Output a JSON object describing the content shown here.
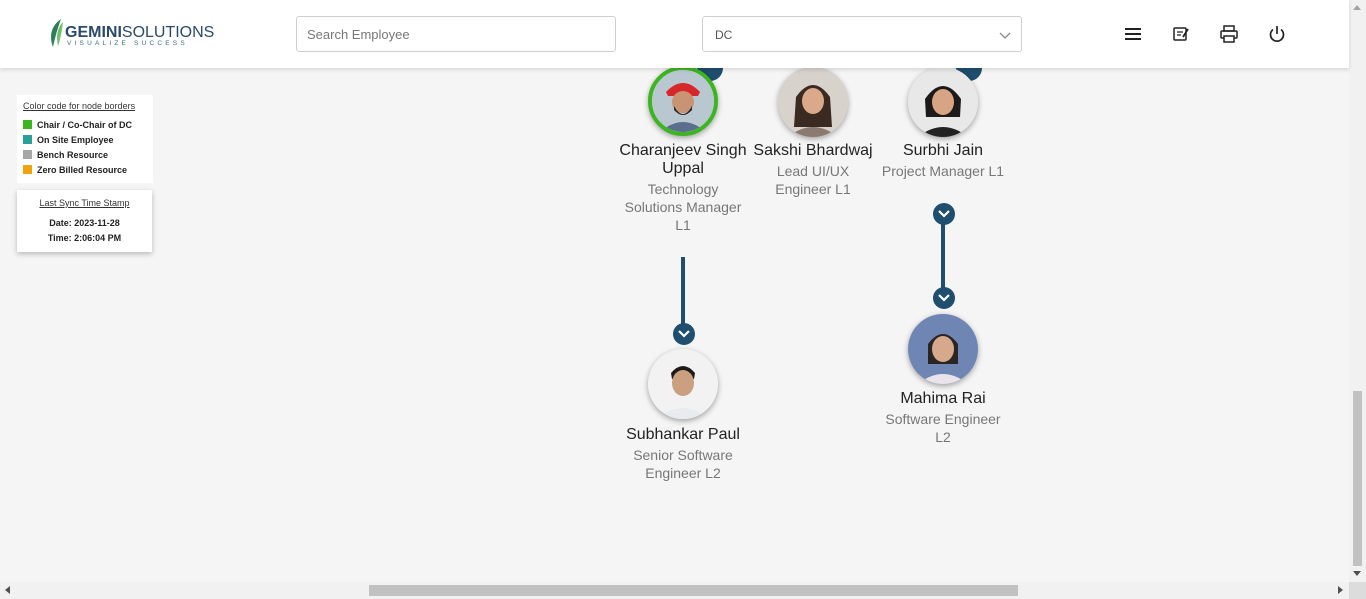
{
  "header": {
    "logo_brand": "GEMINI",
    "logo_word": "SOLUTIONS",
    "logo_tagline": "VISUALIZE SUCCESS",
    "search_placeholder": "Search Employee",
    "department_selected": "DC",
    "icons": [
      "menu-icon",
      "edit-note-icon",
      "print-icon",
      "power-icon"
    ]
  },
  "legend": {
    "title": "Color code for node borders",
    "items": [
      {
        "label": "Chair / Co-Chair of DC",
        "color": "#3cb521"
      },
      {
        "label": "On Site Employee",
        "color": "#2aa198"
      },
      {
        "label": "Bench Resource",
        "color": "#a6a6a6"
      },
      {
        "label": "Zero Billed Resource",
        "color": "#f0a30a"
      }
    ]
  },
  "sync": {
    "title": "Last Sync Time Stamp",
    "date": "Date: 2023-11-28",
    "time": "Time: 2:06:04 PM"
  },
  "nodes": {
    "charanjeev": {
      "name": "Charanjeev Singh Uppal",
      "role": "Technology Solutions Manager L1"
    },
    "sakshi": {
      "name": "Sakshi Bhardwaj",
      "role": "Lead UI/UX Engineer L1"
    },
    "surbhi": {
      "name": "Surbhi Jain",
      "role": "Project Manager L1"
    },
    "subhankar": {
      "name": "Subhankar Paul",
      "role": "Senior Software Engineer L2"
    },
    "mahima": {
      "name": "Mahima Rai",
      "role": "Software Engineer L2"
    }
  },
  "colors": {
    "accent": "#1f4e6e",
    "chair_border": "#3cb521"
  }
}
